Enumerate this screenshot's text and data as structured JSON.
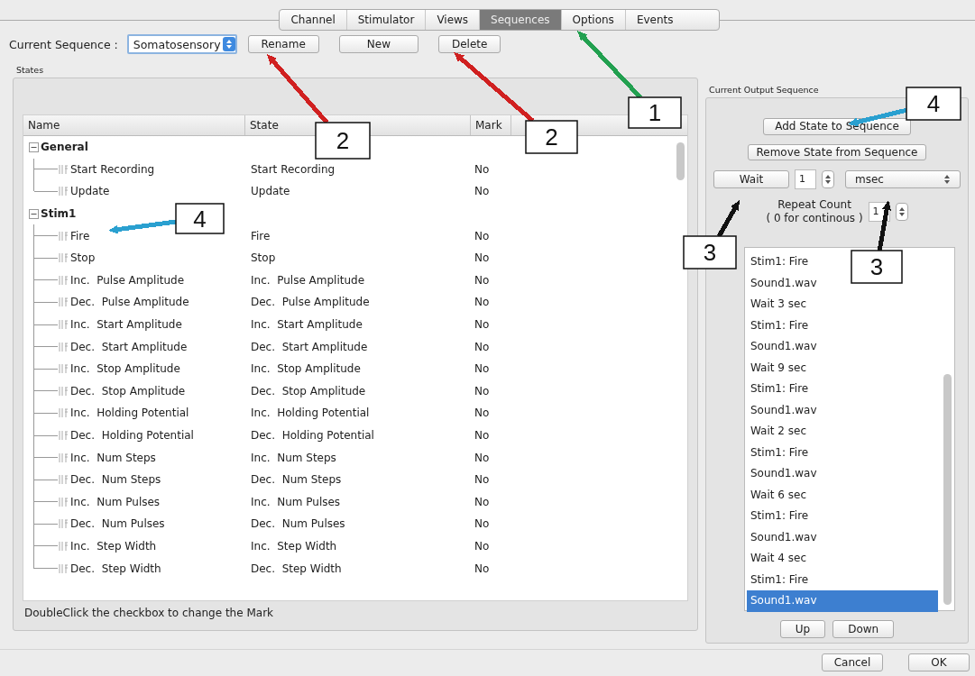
{
  "tabs": [
    {
      "label": "Channel",
      "selected": false
    },
    {
      "label": "Stimulator",
      "selected": false
    },
    {
      "label": "Views",
      "selected": false
    },
    {
      "label": "Sequences",
      "selected": true
    },
    {
      "label": "Options",
      "selected": false
    },
    {
      "label": "Events",
      "selected": false
    }
  ],
  "sequence_bar": {
    "label": "Current Sequence :",
    "value": "Somatosensory",
    "buttons": [
      "Rename",
      "New",
      "Delete"
    ]
  },
  "states": {
    "title": "States",
    "columns": [
      "Name",
      "State",
      "Mark"
    ],
    "tree": [
      {
        "name": "General",
        "expanded": true,
        "children": [
          {
            "name": "Start Recording",
            "state": "Start Recording",
            "mark": "No"
          },
          {
            "name": "Update",
            "state": "Update",
            "mark": "No"
          }
        ]
      },
      {
        "name": "Stim1",
        "expanded": true,
        "children": [
          {
            "name": "Fire",
            "state": "Fire",
            "mark": "No"
          },
          {
            "name": "Stop",
            "state": "Stop",
            "mark": "No"
          },
          {
            "name": "Inc.  Pulse Amplitude",
            "state": "Inc.  Pulse Amplitude",
            "mark": "No"
          },
          {
            "name": "Dec.  Pulse Amplitude",
            "state": "Dec.  Pulse Amplitude",
            "mark": "No"
          },
          {
            "name": "Inc.  Start Amplitude",
            "state": "Inc.  Start Amplitude",
            "mark": "No"
          },
          {
            "name": "Dec.  Start Amplitude",
            "state": "Dec.  Start Amplitude",
            "mark": "No"
          },
          {
            "name": "Inc.  Stop Amplitude",
            "state": "Inc.  Stop Amplitude",
            "mark": "No"
          },
          {
            "name": "Dec.  Stop Amplitude",
            "state": "Dec.  Stop Amplitude",
            "mark": "No"
          },
          {
            "name": "Inc.  Holding Potential",
            "state": "Inc.  Holding Potential",
            "mark": "No"
          },
          {
            "name": "Dec.  Holding Potential",
            "state": "Dec.  Holding Potential",
            "mark": "No"
          },
          {
            "name": "Inc.  Num Steps",
            "state": "Inc.  Num Steps",
            "mark": "No"
          },
          {
            "name": "Dec.  Num Steps",
            "state": "Dec.  Num Steps",
            "mark": "No"
          },
          {
            "name": "Inc.  Num Pulses",
            "state": "Inc.  Num Pulses",
            "mark": "No"
          },
          {
            "name": "Dec.  Num Pulses",
            "state": "Dec.  Num Pulses",
            "mark": "No"
          },
          {
            "name": "Inc.  Step Width",
            "state": "Inc.  Step Width",
            "mark": "No"
          },
          {
            "name": "Dec.  Step Width",
            "state": "Dec.  Step Width",
            "mark": "No"
          }
        ]
      }
    ],
    "hint": "DoubleClick the checkbox to change the Mark"
  },
  "output": {
    "title": "Current Output Sequence",
    "add_button": "Add State to Sequence",
    "remove_button": "Remove State from Sequence",
    "wait_button": "Wait",
    "wait_value": "1",
    "unit": "msec",
    "repeat_label": "Repeat Count",
    "repeat_note": "( 0 for continous )",
    "repeat_value": "1",
    "items": [
      {
        "text": "Stim1: Fire",
        "selected": false
      },
      {
        "text": "Sound1.wav",
        "selected": false
      },
      {
        "text": "Wait 3 sec",
        "selected": false
      },
      {
        "text": "Stim1: Fire",
        "selected": false
      },
      {
        "text": "Sound1.wav",
        "selected": false
      },
      {
        "text": "Wait 9 sec",
        "selected": false
      },
      {
        "text": "Stim1: Fire",
        "selected": false
      },
      {
        "text": "Sound1.wav",
        "selected": false
      },
      {
        "text": "Wait 2 sec",
        "selected": false
      },
      {
        "text": "Stim1: Fire",
        "selected": false
      },
      {
        "text": "Sound1.wav",
        "selected": false
      },
      {
        "text": "Wait 6 sec",
        "selected": false
      },
      {
        "text": "Stim1: Fire",
        "selected": false
      },
      {
        "text": "Sound1.wav",
        "selected": false
      },
      {
        "text": "Wait 4 sec",
        "selected": false
      },
      {
        "text": "Stim1: Fire",
        "selected": false
      },
      {
        "text": "Sound1.wav",
        "selected": true
      }
    ],
    "up_button": "Up",
    "down_button": "Down"
  },
  "dialog_buttons": [
    "Cancel",
    "OK"
  ],
  "callouts": [
    {
      "label": "1",
      "color": "#22a050"
    },
    {
      "label": "2",
      "color": "#d02020"
    },
    {
      "label": "2",
      "color": "#d02020"
    },
    {
      "label": "4",
      "color": "#2aa0d0"
    },
    {
      "label": "4",
      "color": "#2aa0d0"
    },
    {
      "label": "3",
      "color": "#111111"
    },
    {
      "label": "3",
      "color": "#111111"
    }
  ]
}
